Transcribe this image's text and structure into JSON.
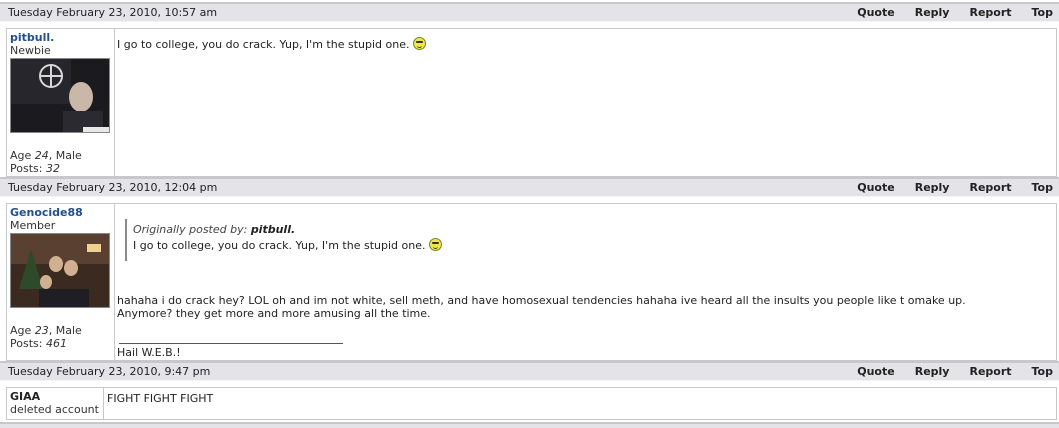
{
  "actions": [
    "Quote",
    "Reply",
    "Report",
    "Top"
  ],
  "posts": [
    {
      "date": "Tuesday February 23, 2010, 10:57 am",
      "author": "pitbull.",
      "rank": "Newbie",
      "age": "24",
      "gender_prefix": "Age ",
      "gender_suffix": ", Male",
      "posts_label": "Posts: ",
      "posts": "32",
      "avatar_caption": "Newgrounds.com",
      "body": "I go to college, you do crack. Yup, I'm the stupid one."
    },
    {
      "date": "Tuesday February 23, 2010, 12:04 pm",
      "author": "Genocide88",
      "rank": "Member",
      "age": "23",
      "gender_prefix": "Age ",
      "gender_suffix": ", Male",
      "posts_label": "Posts: ",
      "posts": "461",
      "quote_prefix": "Originally posted by: ",
      "quote_author": "pitbull.",
      "quote_body": "I go to college, you do crack. Yup, I'm the stupid one.",
      "body_line1": "hahaha i do crack hey? LOL oh and im not white, sell meth, and have homosexual tendencies hahaha ive heard all the insults you people like t omake up.",
      "body_line2": "Anymore? they get more and more amusing all the time.",
      "signature": "Hail W.E.B.!"
    },
    {
      "date": "Tuesday February 23, 2010, 9:47 pm",
      "author": "GIAA",
      "rank": "deleted account",
      "body": "FIGHT FIGHT FIGHT"
    }
  ],
  "colors": {
    "header_bg": "#e4e4e8",
    "border": "#c8c8cc",
    "username": "#1f4f8f"
  }
}
